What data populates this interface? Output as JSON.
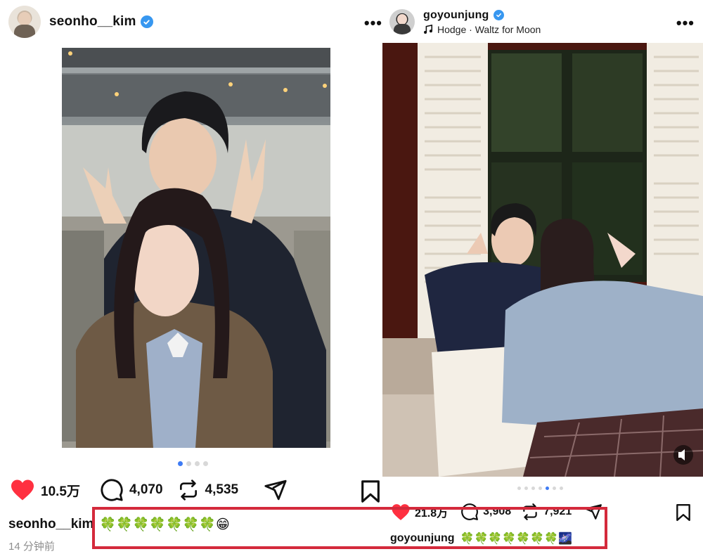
{
  "left_post": {
    "username": "seonho__kim",
    "verified_icon": "verified-badge-icon",
    "more_label": "•••",
    "carousel": {
      "count": 4,
      "active_index": 0
    },
    "actions": {
      "likes": "10.5万",
      "comments": "4,070",
      "reposts": "4,535"
    },
    "caption": {
      "username": "seonho__kim",
      "text": "🍀🍀🍀🍀🍀🍀🍀😁"
    },
    "time": "14 分钟前"
  },
  "right_post": {
    "username": "goyounjung",
    "verified_icon": "verified-badge-icon",
    "music": "Hodge · Waltz for Moon",
    "more_label": "•••",
    "carousel": {
      "count": 7,
      "active_index": 4
    },
    "actions": {
      "likes": "21.8万",
      "comments": "3,908",
      "reposts": "7,921"
    },
    "caption": {
      "username": "goyounjung",
      "text": "🍀🍀🍀🍀🍀🍀🍀🌌"
    }
  },
  "colors": {
    "like_red": "#ff3040",
    "verified_blue": "#3797f0",
    "highlight_red": "#d42a3c",
    "carousel_active": "#3e7bf4"
  }
}
